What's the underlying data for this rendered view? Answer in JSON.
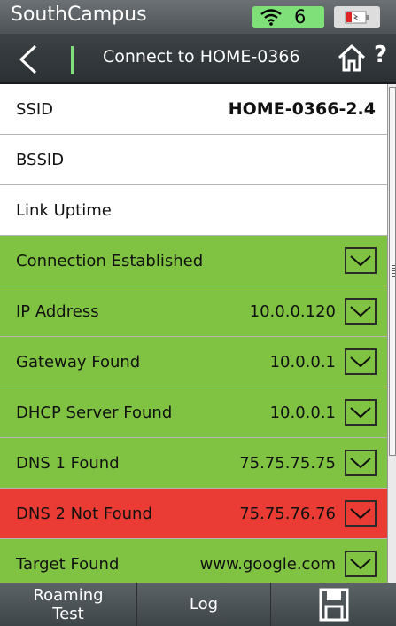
{
  "status_bar": {
    "title": "SouthCampus",
    "wifi_count": "6"
  },
  "nav": {
    "title": "Connect to HOME-0366"
  },
  "rows": [
    {
      "label": "SSID",
      "value": "HOME-0366-2.4",
      "state": "white"
    },
    {
      "label": "BSSID",
      "value": "",
      "state": "white"
    },
    {
      "label": "Link Uptime",
      "value": "",
      "state": "white"
    },
    {
      "label": "Connection Established",
      "value": "",
      "state": "green"
    },
    {
      "label": "IP Address",
      "value": "10.0.0.120",
      "state": "green"
    },
    {
      "label": "Gateway Found",
      "value": "10.0.0.1",
      "state": "green"
    },
    {
      "label": "DHCP Server Found",
      "value": "10.0.0.1",
      "state": "green"
    },
    {
      "label": "DNS 1 Found",
      "value": "75.75.75.75",
      "state": "green"
    },
    {
      "label": "DNS 2 Not Found",
      "value": "75.75.76.76",
      "state": "red"
    },
    {
      "label": "Target Found",
      "value": "www.google.com",
      "state": "green"
    }
  ],
  "bottom_bar": {
    "roaming_label_1": "Roaming",
    "roaming_label_2": "Test",
    "log_label": "Log"
  },
  "colors": {
    "green": "#80c342",
    "red": "#ea3c35",
    "wifi_badge": "#7fe07a"
  }
}
